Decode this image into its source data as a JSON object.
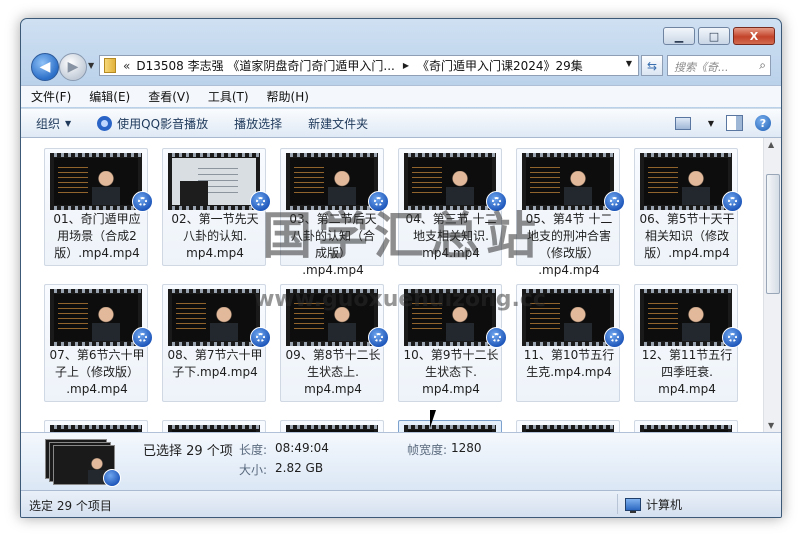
{
  "window": {
    "minimize_glyph": "▁",
    "maximize_glyph": "□",
    "close_glyph": "X"
  },
  "navigation": {
    "back_glyph": "◀",
    "forward_glyph": "▶",
    "history_dropdown": "▼",
    "address_chevrons": "«",
    "breadcrumbs": [
      "D13508 李志强 《道家阴盘奇门奇门遁甲入门...",
      "《奇门遁甲入门课2024》29集"
    ],
    "breadcrumb_separator": "▶",
    "address_dropdown": "▼",
    "refresh_glyph": "⇆",
    "search_placeholder": "搜索《奇...",
    "search_glyph": "⌕"
  },
  "menu": [
    "文件(F)",
    "编辑(E)",
    "查看(V)",
    "工具(T)",
    "帮助(H)"
  ],
  "toolbar": {
    "organize": "组织",
    "play_qq": "使用QQ影音播放",
    "play_selection": "播放选择",
    "new_folder": "新建文件夹",
    "help_glyph": "?",
    "dropdown_glyph": "▼"
  },
  "files": [
    {
      "label": "01、奇门遁甲应用场景（合成2版）.mp4.mp4",
      "thumb": "lecture"
    },
    {
      "label": "02、第一节先天八卦的认知.mp4.mp4",
      "thumb": "board"
    },
    {
      "label": "03、第二节后天八卦的认知（合成版）.mp4.mp4",
      "thumb": "lecture"
    },
    {
      "label": "04、第三节 十二地支相关知识.mp4.mp4",
      "thumb": "lecture"
    },
    {
      "label": "05、第4节 十二地支的刑冲合害（修改版）.mp4.mp4",
      "thumb": "lecture"
    },
    {
      "label": "06、第5节十天干相关知识（修改版）.mp4.mp4",
      "thumb": "lecture"
    },
    {
      "label": "07、第6节六十甲子上（修改版）.mp4.mp4",
      "thumb": "lecture"
    },
    {
      "label": "08、第7节六十甲子下.mp4.mp4",
      "thumb": "lecture"
    },
    {
      "label": "09、第8节十二长生状态上.mp4.mp4",
      "thumb": "lecture"
    },
    {
      "label": "10、第9节十二长生状态下.mp4.mp4",
      "thumb": "lecture"
    },
    {
      "label": "11、第10节五行生克.mp4.mp4",
      "thumb": "lecture"
    },
    {
      "label": "12、第11节五行四季旺衰.mp4.mp4",
      "thumb": "lecture"
    },
    {
      "label": "",
      "thumb": "lecture"
    },
    {
      "label": "",
      "thumb": "lecture"
    },
    {
      "label": "",
      "thumb": "lecture"
    },
    {
      "label": "",
      "thumb": "lecture"
    },
    {
      "label": "",
      "thumb": "lecture"
    },
    {
      "label": "",
      "thumb": "lecture"
    }
  ],
  "file_labels_display": [
    [
      "01、奇门遁甲应",
      "用场景（合成2",
      "版）.mp4.mp4"
    ],
    [
      "02、第一节先天",
      "八卦的认知.",
      "mp4.mp4"
    ],
    [
      "03、第二节后天",
      "八卦的认知（合",
      "成版）",
      ".mp4.mp4"
    ],
    [
      "04、第三节 十二",
      "地支相关知识.",
      "mp4.mp4"
    ],
    [
      "05、第4节 十二",
      "地支的刑冲合害",
      "（修改版）",
      ".mp4.mp4"
    ],
    [
      "06、第5节十天干",
      "相关知识（修改",
      "版）.mp4.mp4"
    ],
    [
      "07、第6节六十甲",
      "子上（修改版）",
      ".mp4.mp4"
    ],
    [
      "08、第7节六十甲",
      "子下.mp4.mp4"
    ],
    [
      "09、第8节十二长",
      "生状态上.",
      "mp4.mp4"
    ],
    [
      "10、第9节十二长",
      "生状态下.",
      "mp4.mp4"
    ],
    [
      "11、第10节五行",
      "生克.mp4.mp4"
    ],
    [
      "12、第11节五行",
      "四季旺衰.",
      "mp4.mp4"
    ]
  ],
  "details": {
    "selected": "已选择 29 个项",
    "length_key": "长度:",
    "length_value": "08:49:04",
    "size_key": "大小:",
    "size_value": "2.82 GB",
    "framewidth_key": "帧宽度:",
    "framewidth_value": "1280"
  },
  "status": {
    "left": "选定 29 个项目",
    "right": "计算机"
  },
  "watermark": {
    "title": "国学汇总站",
    "url": "www.guoxuehuizong.cc"
  },
  "scroll": {
    "up": "▲",
    "down": "▼"
  }
}
